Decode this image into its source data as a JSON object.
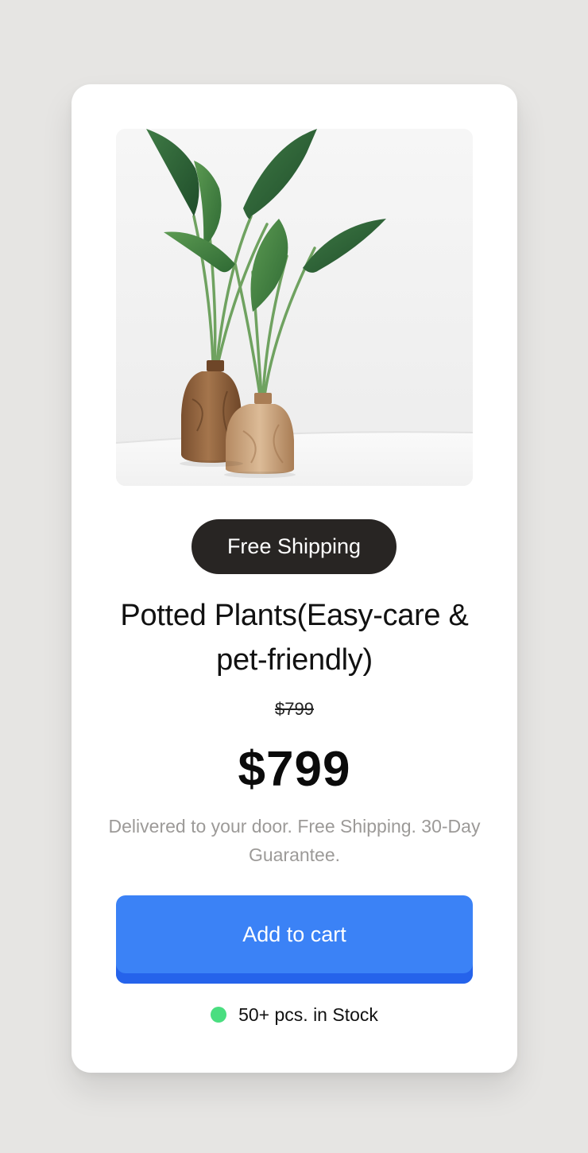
{
  "product": {
    "image_alt": "Two wooden vases with green leafy plants",
    "badge": "Free Shipping",
    "title": "Potted Plants(Easy-care & pet-friendly)",
    "old_price": "$799",
    "price": "$799",
    "description": "Delivered to your door. Free Shipping. 30-Day Guarantee.",
    "add_to_cart_label": "Add to cart",
    "stock_text": "50+ pcs. in Stock"
  },
  "colors": {
    "page_background": "#e6e5e3",
    "card_background": "#ffffff",
    "badge_background": "#282523",
    "button_background": "#3b82f6",
    "button_shadow": "#2563eb",
    "stock_indicator": "#4ade80",
    "muted_text": "#9c9a98"
  }
}
